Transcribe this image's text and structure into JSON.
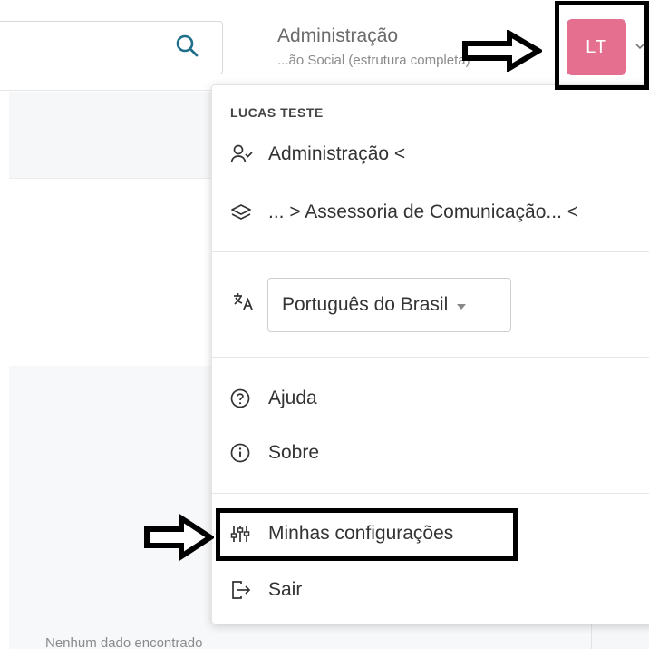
{
  "topbar": {
    "search_icon": "search-icon",
    "tenant_title": "Administração",
    "tenant_subtitle": "...ão Social (estrutura completa)",
    "avatar_initials": "LT",
    "avatar_color": "#e46f8e"
  },
  "menu": {
    "user_name": "LUCAS TESTE",
    "role_label": "Administração <",
    "org_label": "... > Assessoria de Comunicação... <",
    "language": {
      "selected": "Português do Brasil"
    },
    "help_label": "Ajuda",
    "about_label": "Sobre",
    "settings_label": "Minhas configurações",
    "logout_label": "Sair"
  },
  "content": {
    "empty_text": "Nenhum dado encontrado"
  },
  "colors": {
    "accent": "#e46f8e",
    "annotation": "#000000",
    "search_icon": "#1f6f8b"
  }
}
